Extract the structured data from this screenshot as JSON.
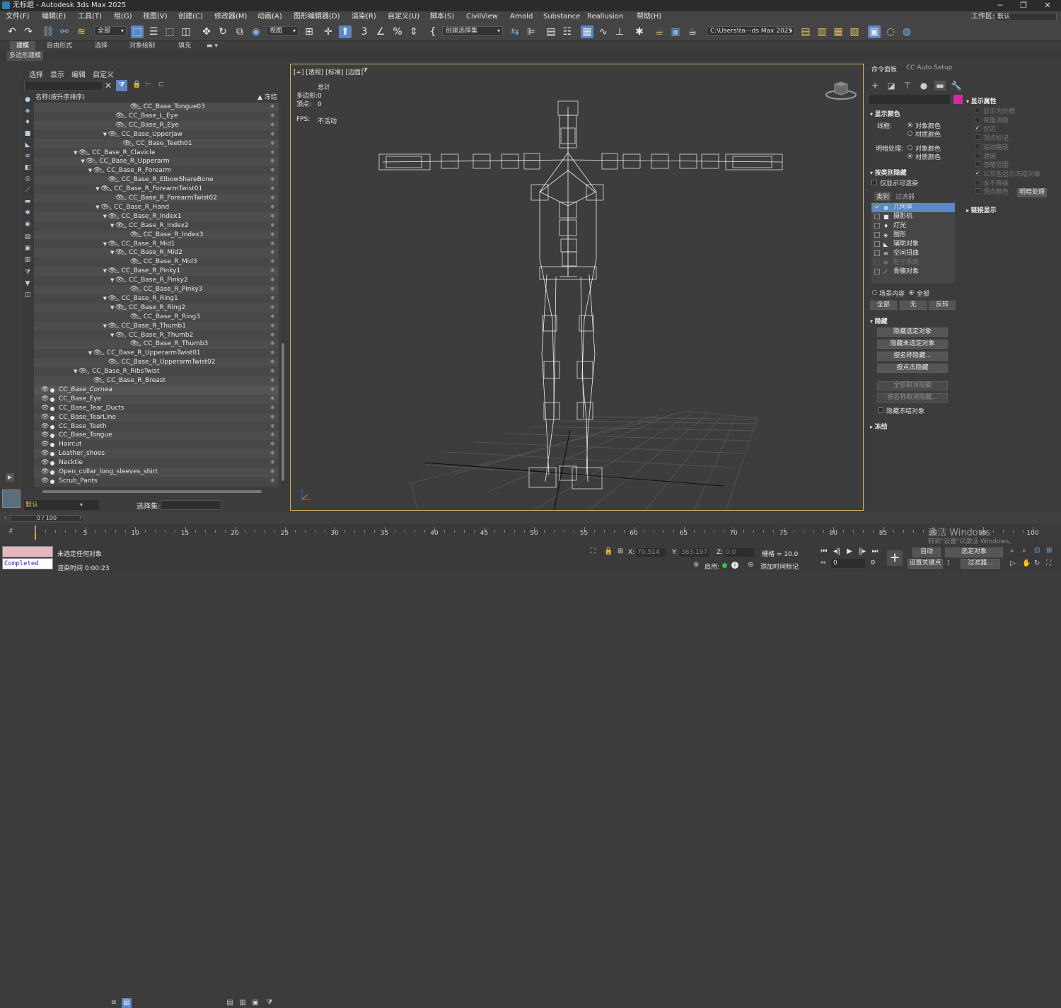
{
  "window": {
    "title": "无标题 - Autodesk 3ds Max 2025",
    "minimize": "─",
    "maximize": "❐",
    "close": "✕"
  },
  "menu": [
    "文件(F)",
    "编辑(E)",
    "工具(T)",
    "组(G)",
    "视图(V)",
    "创建(C)",
    "修改器(M)",
    "动画(A)",
    "图形编辑器(D)",
    "渲染(R)",
    "自定义(U)",
    "脚本(S)",
    "CivilView",
    "Arnold",
    "Substance",
    "Reallusion",
    "帮助(H)"
  ],
  "workspace": {
    "label": "工作区:",
    "value": "默认"
  },
  "toolbar": {
    "filter_select": "全部",
    "ref_coord_select": "视图",
    "named_selset": "创建选择集",
    "project_path": "C:\\Users\\ta⋯ds Max 2025"
  },
  "ribbon": {
    "tabs": [
      "建模",
      "自由形式",
      "选择",
      "对象绘制",
      "填充"
    ],
    "sub": "多边形建模"
  },
  "explorer": {
    "tabs": [
      "选择",
      "显示",
      "编辑",
      "自定义"
    ],
    "col_name": "名称(按升序排序)",
    "col_freeze": "▲ 冻结",
    "rows": [
      {
        "label": "CC_Base_Tongue03",
        "lvl": 12,
        "arrow": false,
        "type": "bone"
      },
      {
        "label": "CC_Base_L_Eye",
        "lvl": 10,
        "arrow": false,
        "type": "bone"
      },
      {
        "label": "CC_Base_R_Eye",
        "lvl": 10,
        "arrow": false,
        "type": "bone"
      },
      {
        "label": "CC_Base_UpperJaw",
        "lvl": 9,
        "arrow": true,
        "type": "bone"
      },
      {
        "label": "CC_Base_Teeth01",
        "lvl": 11,
        "arrow": false,
        "type": "bone"
      },
      {
        "label": "CC_Base_R_Clavicle",
        "lvl": 5,
        "arrow": true,
        "type": "bone"
      },
      {
        "label": "CC_Base_R_Upperarm",
        "lvl": 6,
        "arrow": true,
        "type": "bone"
      },
      {
        "label": "CC_Base_R_Forearm",
        "lvl": 7,
        "arrow": true,
        "type": "bone"
      },
      {
        "label": "CC_Base_R_ElbowShareBone",
        "lvl": 9,
        "arrow": false,
        "type": "bone"
      },
      {
        "label": "CC_Base_R_ForearmTwist01",
        "lvl": 8,
        "arrow": true,
        "type": "bone"
      },
      {
        "label": "CC_Base_R_ForearmTwist02",
        "lvl": 10,
        "arrow": false,
        "type": "bone"
      },
      {
        "label": "CC_Base_R_Hand",
        "lvl": 8,
        "arrow": true,
        "type": "bone"
      },
      {
        "label": "CC_Base_R_Index1",
        "lvl": 9,
        "arrow": true,
        "type": "bone"
      },
      {
        "label": "CC_Base_R_Index2",
        "lvl": 10,
        "arrow": true,
        "type": "bone"
      },
      {
        "label": "CC_Base_R_Index3",
        "lvl": 12,
        "arrow": false,
        "type": "bone"
      },
      {
        "label": "CC_Base_R_Mid1",
        "lvl": 9,
        "arrow": true,
        "type": "bone"
      },
      {
        "label": "CC_Base_R_Mid2",
        "lvl": 10,
        "arrow": true,
        "type": "bone"
      },
      {
        "label": "CC_Base_R_Mid3",
        "lvl": 12,
        "arrow": false,
        "type": "bone"
      },
      {
        "label": "CC_Base_R_Pinky1",
        "lvl": 9,
        "arrow": true,
        "type": "bone"
      },
      {
        "label": "CC_Base_R_Pinky2",
        "lvl": 10,
        "arrow": true,
        "type": "bone"
      },
      {
        "label": "CC_Base_R_Pinky3",
        "lvl": 12,
        "arrow": false,
        "type": "bone"
      },
      {
        "label": "CC_Base_R_Ring1",
        "lvl": 9,
        "arrow": true,
        "type": "bone"
      },
      {
        "label": "CC_Base_R_Ring2",
        "lvl": 10,
        "arrow": true,
        "type": "bone"
      },
      {
        "label": "CC_Base_R_Ring3",
        "lvl": 12,
        "arrow": false,
        "type": "bone"
      },
      {
        "label": "CC_Base_R_Thumb1",
        "lvl": 9,
        "arrow": true,
        "type": "bone"
      },
      {
        "label": "CC_Base_R_Thumb2",
        "lvl": 10,
        "arrow": true,
        "type": "bone"
      },
      {
        "label": "CC_Base_R_Thumb3",
        "lvl": 12,
        "arrow": false,
        "type": "bone"
      },
      {
        "label": "CC_Base_R_UpperarmTwist01",
        "lvl": 7,
        "arrow": true,
        "type": "bone"
      },
      {
        "label": "CC_Base_R_UpperarmTwist02",
        "lvl": 9,
        "arrow": false,
        "type": "bone"
      },
      {
        "label": "CC_Base_R_RibsTwist",
        "lvl": 5,
        "arrow": true,
        "type": "bone"
      },
      {
        "label": "CC_Base_R_Breast",
        "lvl": 7,
        "arrow": false,
        "type": "bone"
      },
      {
        "label": "CC_Base_Cornea",
        "lvl": 0,
        "arrow": false,
        "type": "geo",
        "italic": true
      },
      {
        "label": "CC_Base_Eye",
        "lvl": 0,
        "arrow": false,
        "type": "geo"
      },
      {
        "label": "CC_Base_Tear_Ducts",
        "lvl": 0,
        "arrow": false,
        "type": "geo"
      },
      {
        "label": "CC_Base_TearLine",
        "lvl": 0,
        "arrow": false,
        "type": "geo"
      },
      {
        "label": "CC_Base_Teeth",
        "lvl": 0,
        "arrow": false,
        "type": "geo"
      },
      {
        "label": "CC_Base_Tongue",
        "lvl": 0,
        "arrow": false,
        "type": "geo"
      },
      {
        "label": "Haircut",
        "lvl": 0,
        "arrow": false,
        "type": "geo"
      },
      {
        "label": "Leather_shoes",
        "lvl": 0,
        "arrow": false,
        "type": "geo"
      },
      {
        "label": "Necktie",
        "lvl": 0,
        "arrow": false,
        "type": "geo"
      },
      {
        "label": "Open_collar_long_sleeves_shirt",
        "lvl": 0,
        "arrow": false,
        "type": "geo"
      },
      {
        "label": "Scrub_Pants",
        "lvl": 0,
        "arrow": false,
        "type": "geo"
      }
    ]
  },
  "layer": {
    "name": "默认",
    "selset_label": "选择集:"
  },
  "viewport": {
    "label": "[+] [透视] [标准] [边面]",
    "stats_title": "总计",
    "polys_label": "多边形:",
    "polys": "0",
    "verts_label": "顶点:",
    "verts": "0",
    "fps_label": "FPS:",
    "fps": "不活动"
  },
  "cmd": {
    "tab1": "命令面板",
    "tab2": "CC Auto Setup",
    "display_color": {
      "title": "显示颜色",
      "wire_label": "线框:",
      "shade_label": "明暗处理:",
      "opt1": "对象颜色",
      "opt2": "材质颜色"
    },
    "hide_by_cat": {
      "title": "按类别隐藏",
      "render_only": "仅显示可渲染",
      "tab_cat": "类别",
      "tab_filter": "过滤器",
      "cats": [
        "几何体",
        "摄影机",
        "灯光",
        "图形",
        "辅助对象",
        "空间扭曲",
        "粒子系统",
        "骨骼对象"
      ],
      "scene_content": "场景内容",
      "all": "全部",
      "btn_all": "全部",
      "btn_none": "无",
      "btn_invert": "反转"
    },
    "hide": {
      "title": "隐藏",
      "buttons": [
        "隐藏选定对象",
        "隐藏未选定对象",
        "按名称隐藏...",
        "按点击隐藏",
        "全部取消隐藏",
        "按名称取消隐藏..."
      ],
      "hide_frozen": "隐藏冻结对象"
    },
    "freeze": {
      "title": "冻结"
    },
    "disp_props": {
      "title": "显示属性",
      "items": [
        "显示为外框",
        "背面消隐",
        "仅边",
        "顶点标记",
        "运动路径",
        "透明",
        "忽略范围",
        "以灰色显示冻结对象",
        "永不降级",
        "顶点颜色"
      ],
      "shade_btn": "明暗处理"
    },
    "link_display": {
      "title": "链接显示"
    }
  },
  "timeline": {
    "slider": "0 / 100",
    "ticks": [
      0,
      5,
      10,
      15,
      20,
      25,
      30,
      35,
      40,
      45,
      50,
      55,
      60,
      65,
      70,
      75,
      80,
      85,
      90,
      95,
      100
    ]
  },
  "status": {
    "msg1": "未选定任何对象",
    "msg2": "渲染时间  0:00:23",
    "script_out": "Completed",
    "x_label": "X:",
    "x": "70.514",
    "y_label": "Y:",
    "y": "383.197",
    "z_label": "Z:",
    "z": "0.0",
    "grid": "栅格 = 10.0",
    "enable": "启用:",
    "addkey": "添加时间标记",
    "auto": "自动",
    "selobj": "选定对象",
    "setkey": "设置关键点",
    "filters": "过滤器...",
    "frame": "0"
  },
  "watermark": {
    "line1": "激活 Windows",
    "line2": "转到\"设置\"以激活 Windows。"
  }
}
